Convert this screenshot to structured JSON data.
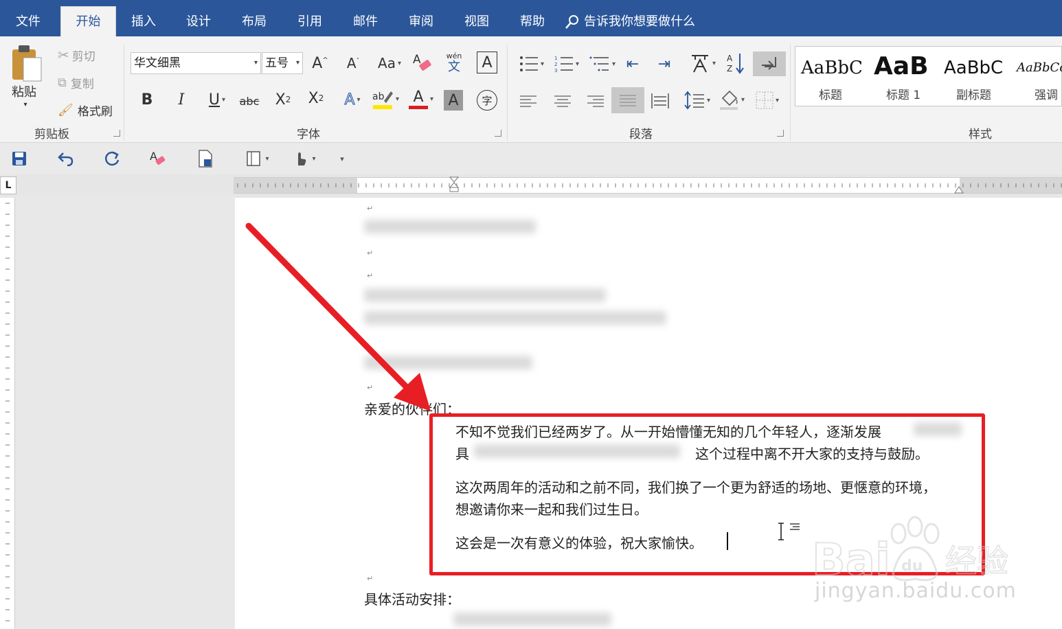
{
  "tabs": {
    "file": "文件",
    "home": "开始",
    "insert": "插入",
    "design": "设计",
    "layout": "布局",
    "references": "引用",
    "mailings": "邮件",
    "review": "审阅",
    "view": "视图",
    "help": "帮助",
    "tell_me": "告诉我你想要做什么"
  },
  "clipboard": {
    "paste": "粘贴",
    "cut": "剪切",
    "copy": "复制",
    "format_painter": "格式刷",
    "group_label": "剪贴板"
  },
  "font": {
    "name": "华文细黑",
    "size": "五号",
    "change_case": "Aa",
    "pinyin_top": "wén",
    "pinyin_bottom": "文",
    "char_border": "A",
    "bold": "B",
    "italic": "I",
    "underline": "U",
    "strikethrough": "abc",
    "subscript": "X",
    "superscript": "X",
    "text_effects": "A",
    "font_color": "A",
    "char_shading": "A",
    "enclose": "字",
    "group_label": "字体"
  },
  "paragraph": {
    "group_label": "段落"
  },
  "styles": {
    "items": [
      {
        "sample": "AaBbC",
        "name": "标题"
      },
      {
        "sample": "AaB",
        "name": "标题 1"
      },
      {
        "sample": "AaBbC",
        "name": "副标题"
      },
      {
        "sample": "AaBbCc",
        "name": "强调"
      }
    ],
    "group_label": "样式"
  },
  "ruler": {
    "corner": "L"
  },
  "document": {
    "greeting": "亲爱的伙伴们：",
    "p1_line1": "不知不觉我们已经两岁了。从一开始懵懂无知的几个年轻人，逐渐发展",
    "p1_line2_start": "具",
    "p1_line2_end": "这个过程中离不开大家的支持与鼓励。",
    "p2_line1": "这次两周年的活动和之前不同，我们换了一个更为舒适的场地、更惬意的环境，",
    "p2_line2": "想邀请你来一起和我们过生日。",
    "p3": "这会是一次有意义的体验，祝大家愉快。",
    "schedule_heading": "具体活动安排：",
    "para_mark": "↵"
  },
  "watermark": {
    "text": "Bai 经验",
    "sub": "jingyan.baidu.com"
  },
  "colors": {
    "ribbon_blue": "#2b579a",
    "highlight_red": "#e81e25",
    "font_color_red": "#d92020",
    "highlight_yellow": "#ffe600"
  }
}
